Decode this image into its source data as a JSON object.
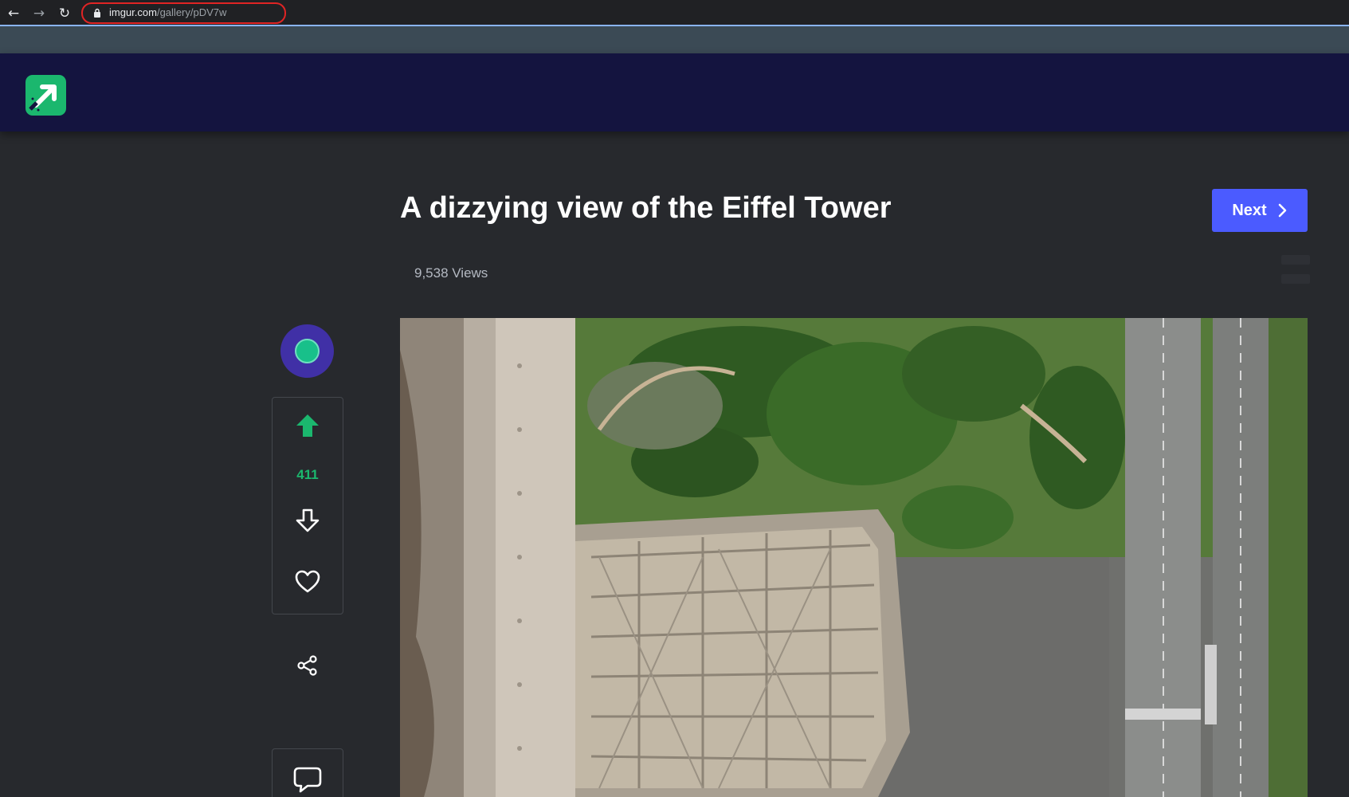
{
  "browser": {
    "url_domain": "imgur.com",
    "url_path": "/gallery/pDV7w"
  },
  "post": {
    "title": "A dizzying view of the Eiffel Tower",
    "views": "9,538 Views",
    "next_label": "Next"
  },
  "votes": {
    "count": "411"
  },
  "colors": {
    "header_bg": "#14143f",
    "page_bg": "#27292d",
    "accent": "#1bb76e",
    "next_button": "#4b5bff"
  },
  "icons": [
    "back-icon",
    "forward-icon",
    "reload-icon",
    "lock-icon",
    "imgur-logo",
    "upvote-icon",
    "downvote-icon",
    "heart-icon",
    "share-icon",
    "comment-icon",
    "chevron-right-icon"
  ]
}
